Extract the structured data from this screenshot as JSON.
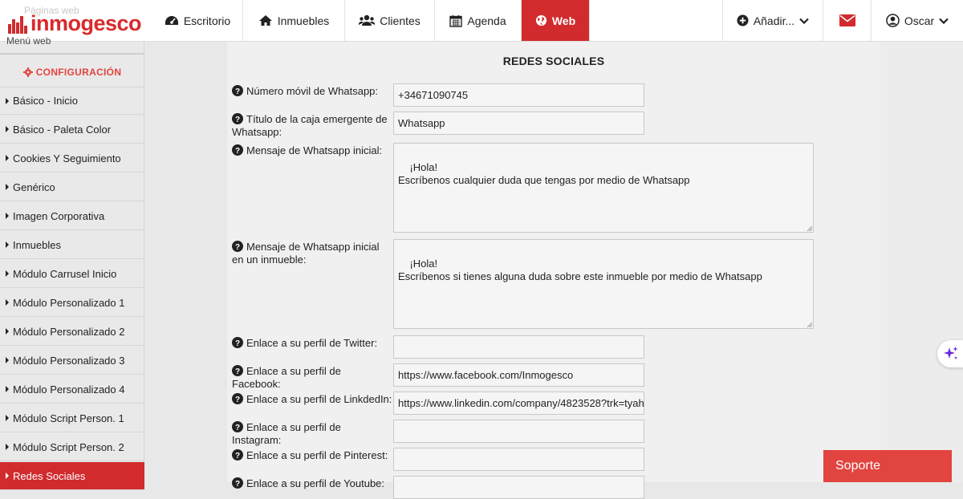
{
  "nav": {
    "logo_text": "inmogesco",
    "logo_ghost_text": "Páginas web",
    "tabs": [
      {
        "label": "Escritorio",
        "icon": "dashboard-icon"
      },
      {
        "label": "Inmuebles",
        "icon": "home-icon"
      },
      {
        "label": "Clientes",
        "icon": "users-icon"
      },
      {
        "label": "Agenda",
        "icon": "calendar-icon"
      },
      {
        "label": "Web",
        "icon": "globe-icon",
        "active": true
      }
    ],
    "add_label": "Añadir...",
    "user_label": "Oscar",
    "accent_color": "#d12b2e"
  },
  "sidebar": {
    "ghost_label": "Menú web",
    "section_title": "CONFIGURACIÓN",
    "items": [
      {
        "label": "Básico - Inicio"
      },
      {
        "label": "Básico - Paleta Color"
      },
      {
        "label": "Cookies Y Seguimiento"
      },
      {
        "label": "Genérico"
      },
      {
        "label": "Imagen Corporativa"
      },
      {
        "label": "Inmuebles"
      },
      {
        "label": "Módulo Carrusel Inicio"
      },
      {
        "label": "Módulo Personalizado 1"
      },
      {
        "label": "Módulo Personalizado 2"
      },
      {
        "label": "Módulo Personalizado 3"
      },
      {
        "label": "Módulo Personalizado 4"
      },
      {
        "label": "Módulo Script Person. 1"
      },
      {
        "label": "Módulo Script Person. 2"
      },
      {
        "label": "Redes Sociales",
        "active": true
      }
    ]
  },
  "form": {
    "title": "REDES SOCIALES",
    "fields": [
      {
        "label": "Número móvil de Whatsapp:",
        "value": "+34671090745"
      },
      {
        "label": "Título de la caja emergente de Whatsapp:",
        "value": "Whatsapp"
      },
      {
        "label": "Mensaje de Whatsapp inicial:",
        "value": "¡Hola!\nEscríbenos cualquier duda que tengas por medio de Whatsapp"
      },
      {
        "label": "Mensaje de Whatsapp inicial en un inmueble:",
        "value": "¡Hola!\nEscríbenos si tienes alguna duda sobre este inmueble por medio de Whatsapp"
      },
      {
        "label": "Enlace a su perfil de Twitter:",
        "value": ""
      },
      {
        "label": "Enlace a su perfil de Facebook:",
        "value": "https://www.facebook.com/Inmogesco"
      },
      {
        "label": "Enlace a su perfil de LinkdedIn:",
        "value": "https://www.linkedin.com/company/4823528?trk=tyah"
      },
      {
        "label": "Enlace a su perfil de Instagram:",
        "value": ""
      },
      {
        "label": "Enlace a su perfil de Pinterest:",
        "value": ""
      },
      {
        "label": "Enlace a su perfil de Youtube:",
        "value": ""
      }
    ]
  },
  "support_label": "Soporte"
}
